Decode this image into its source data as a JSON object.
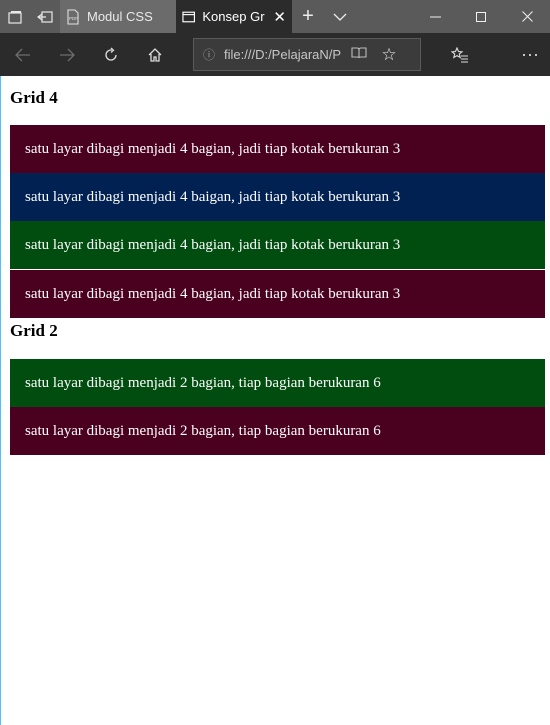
{
  "browser": {
    "tabs": [
      {
        "label": "Modul CSS Re",
        "active": false
      },
      {
        "label": "Konsep Grid",
        "active": true
      }
    ],
    "address": "file:///D:/PelajaraN/P",
    "colors": {
      "tabbar": "#5a5a5a",
      "navbar": "#2b2b2b"
    }
  },
  "page": {
    "sections": [
      {
        "heading": "Grid 4",
        "rows": [
          {
            "text": "satu layar dibagi menjadi 4 bagian, jadi tiap kotak berukuran 3",
            "color": "#4a001f"
          },
          {
            "text": "satu layar dibagi menjadi 4 baigan, jadi tiap kotak berukuran 3",
            "color": "#002152"
          },
          {
            "text": "satu layar dibagi menjadi 4 bagian, jadi tiap kotak berukuran 3",
            "color": "#004d0f"
          },
          {
            "text": "satu layar dibagi menjadi 4 bagian, jadi tiap kotak berukuran 3",
            "color": "#4a001f"
          }
        ]
      },
      {
        "heading": "Grid 2",
        "rows": [
          {
            "text": "satu layar dibagi menjadi 2 bagian, tiap bagian berukuran 6",
            "color": "#004d0f"
          },
          {
            "text": "satu layar dibagi menjadi 2 bagian, tiap bagian berukuran 6",
            "color": "#4a001f"
          }
        ]
      }
    ]
  }
}
